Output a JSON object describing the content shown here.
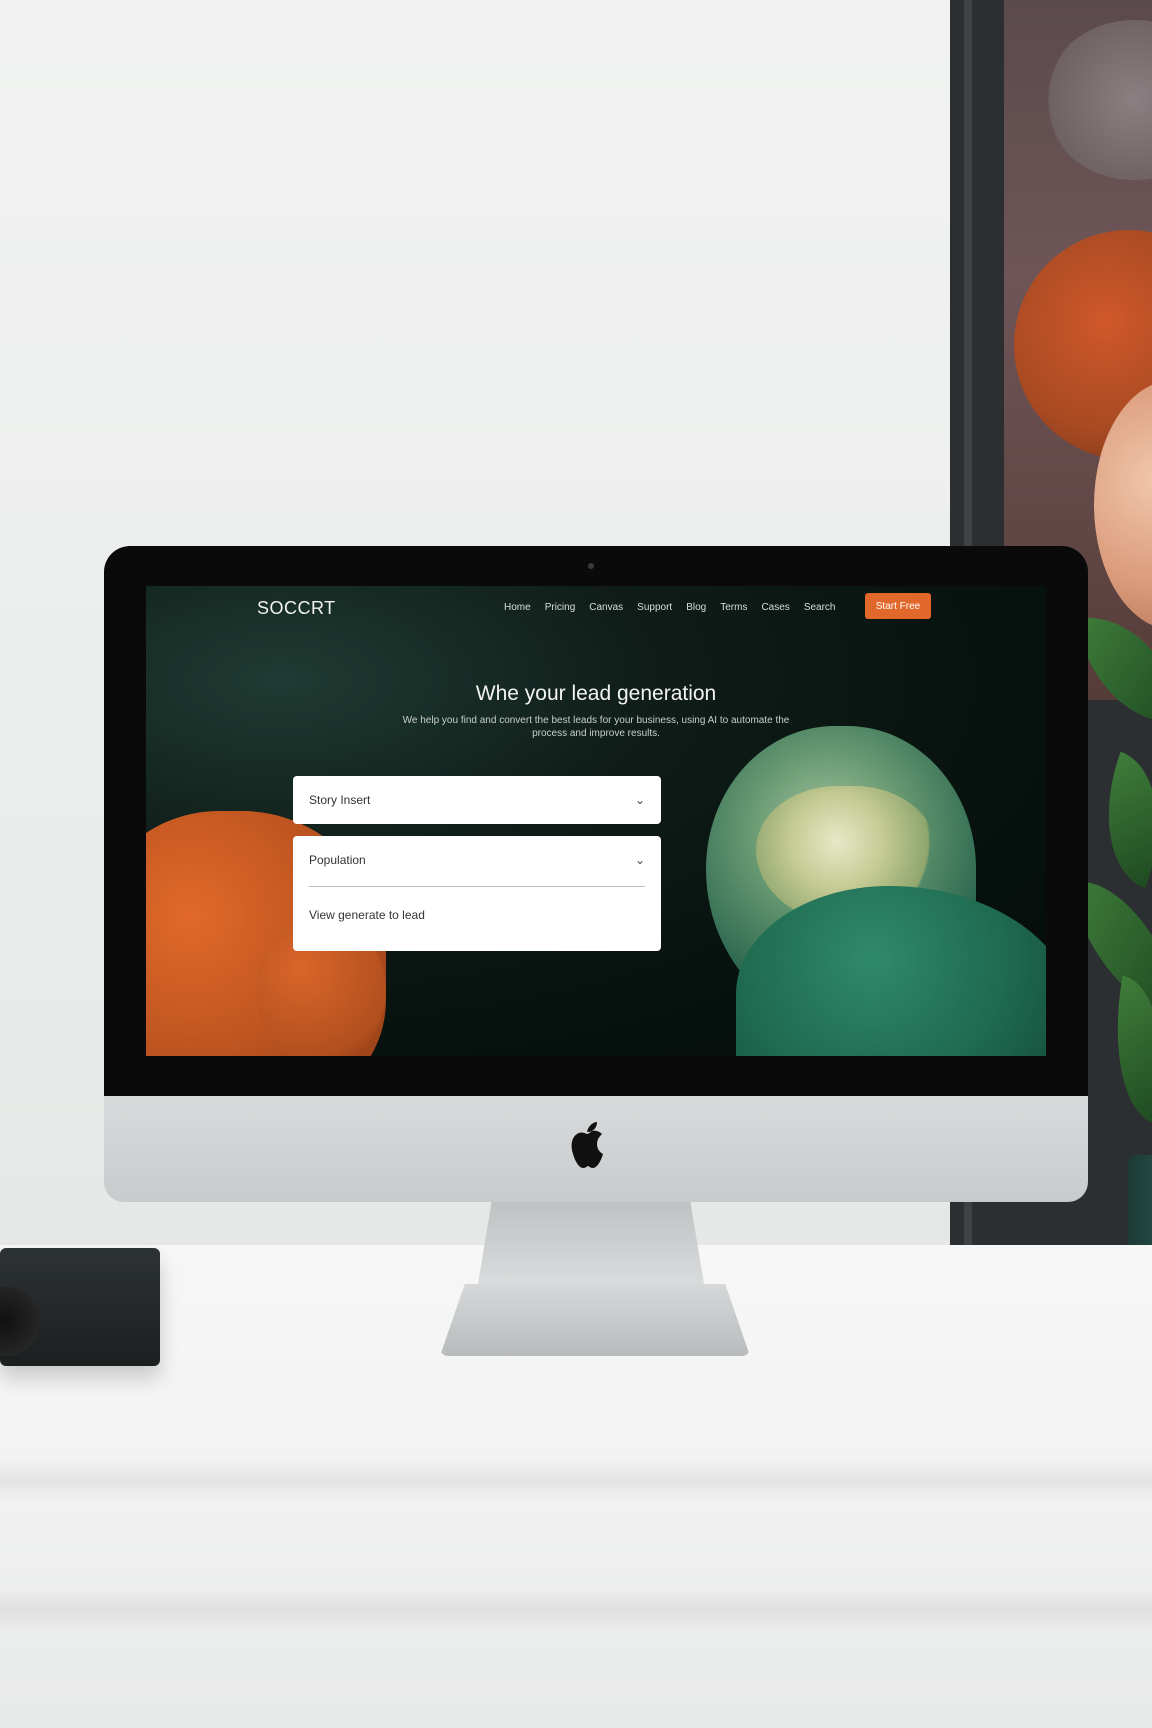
{
  "site": {
    "brand": "SOCCRT",
    "nav_links": [
      "Home",
      "Pricing",
      "Canvas",
      "Support",
      "Blog",
      "Terms",
      "Cases",
      "Search"
    ],
    "cta_label": "Start Free",
    "hero_title": "Whe your lead generation",
    "hero_subtitle": "We help you find and convert the best leads for your business, using AI to automate the process and improve results."
  },
  "form": {
    "select_1": "Story Insert",
    "select_2": "Population",
    "note": "View generate to lead"
  },
  "colors": {
    "accent": "#e1672b",
    "screen_bg": "#06100d",
    "green": "#2f6a52",
    "orange": "#c25621"
  }
}
